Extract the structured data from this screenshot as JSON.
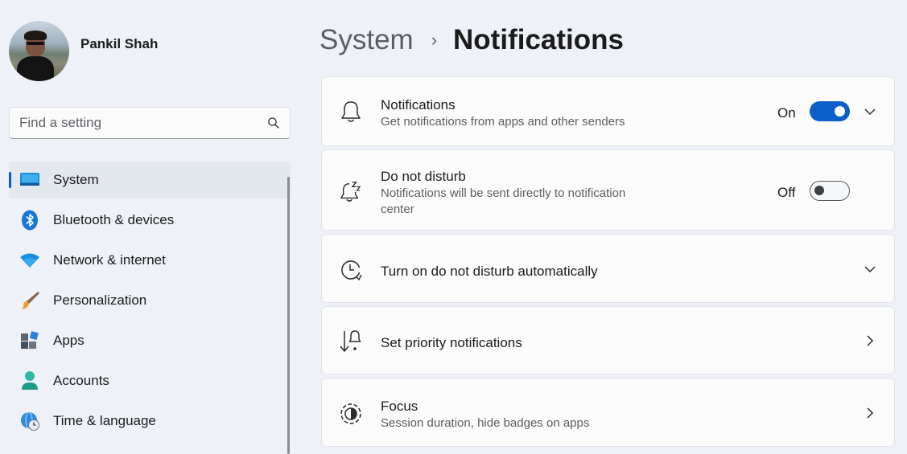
{
  "user": {
    "name": "Pankil Shah"
  },
  "search": {
    "placeholder": "Find a setting"
  },
  "sidebar": {
    "items": [
      {
        "label": "System",
        "icon": "system-icon",
        "active": true
      },
      {
        "label": "Bluetooth & devices",
        "icon": "bluetooth-icon"
      },
      {
        "label": "Network & internet",
        "icon": "wifi-icon"
      },
      {
        "label": "Personalization",
        "icon": "brush-icon"
      },
      {
        "label": "Apps",
        "icon": "apps-icon"
      },
      {
        "label": "Accounts",
        "icon": "account-icon"
      },
      {
        "label": "Time & language",
        "icon": "globe-clock-icon"
      }
    ]
  },
  "header": {
    "parent": "System",
    "separator": "›",
    "current": "Notifications"
  },
  "settings": [
    {
      "title": "Notifications",
      "description": "Get notifications from apps and other senders",
      "state": "On",
      "toggle": true,
      "icon": "bell-icon",
      "control": "chevron-down"
    },
    {
      "title": "Do not disturb",
      "description": "Notifications will be sent directly to notification center",
      "state": "Off",
      "toggle": false,
      "icon": "bell-snooze-icon"
    },
    {
      "title": "Turn on do not disturb automatically",
      "icon": "clock-icon",
      "control": "chevron-down"
    },
    {
      "title": "Set priority notifications",
      "icon": "priority-icon",
      "control": "chevron-right"
    },
    {
      "title": "Focus",
      "description": "Session duration, hide badges on apps",
      "icon": "focus-icon",
      "control": "chevron-right"
    }
  ],
  "colors": {
    "accent": "#0a5fc8",
    "background": "#eef1f7",
    "card": "#fbfbfc"
  }
}
